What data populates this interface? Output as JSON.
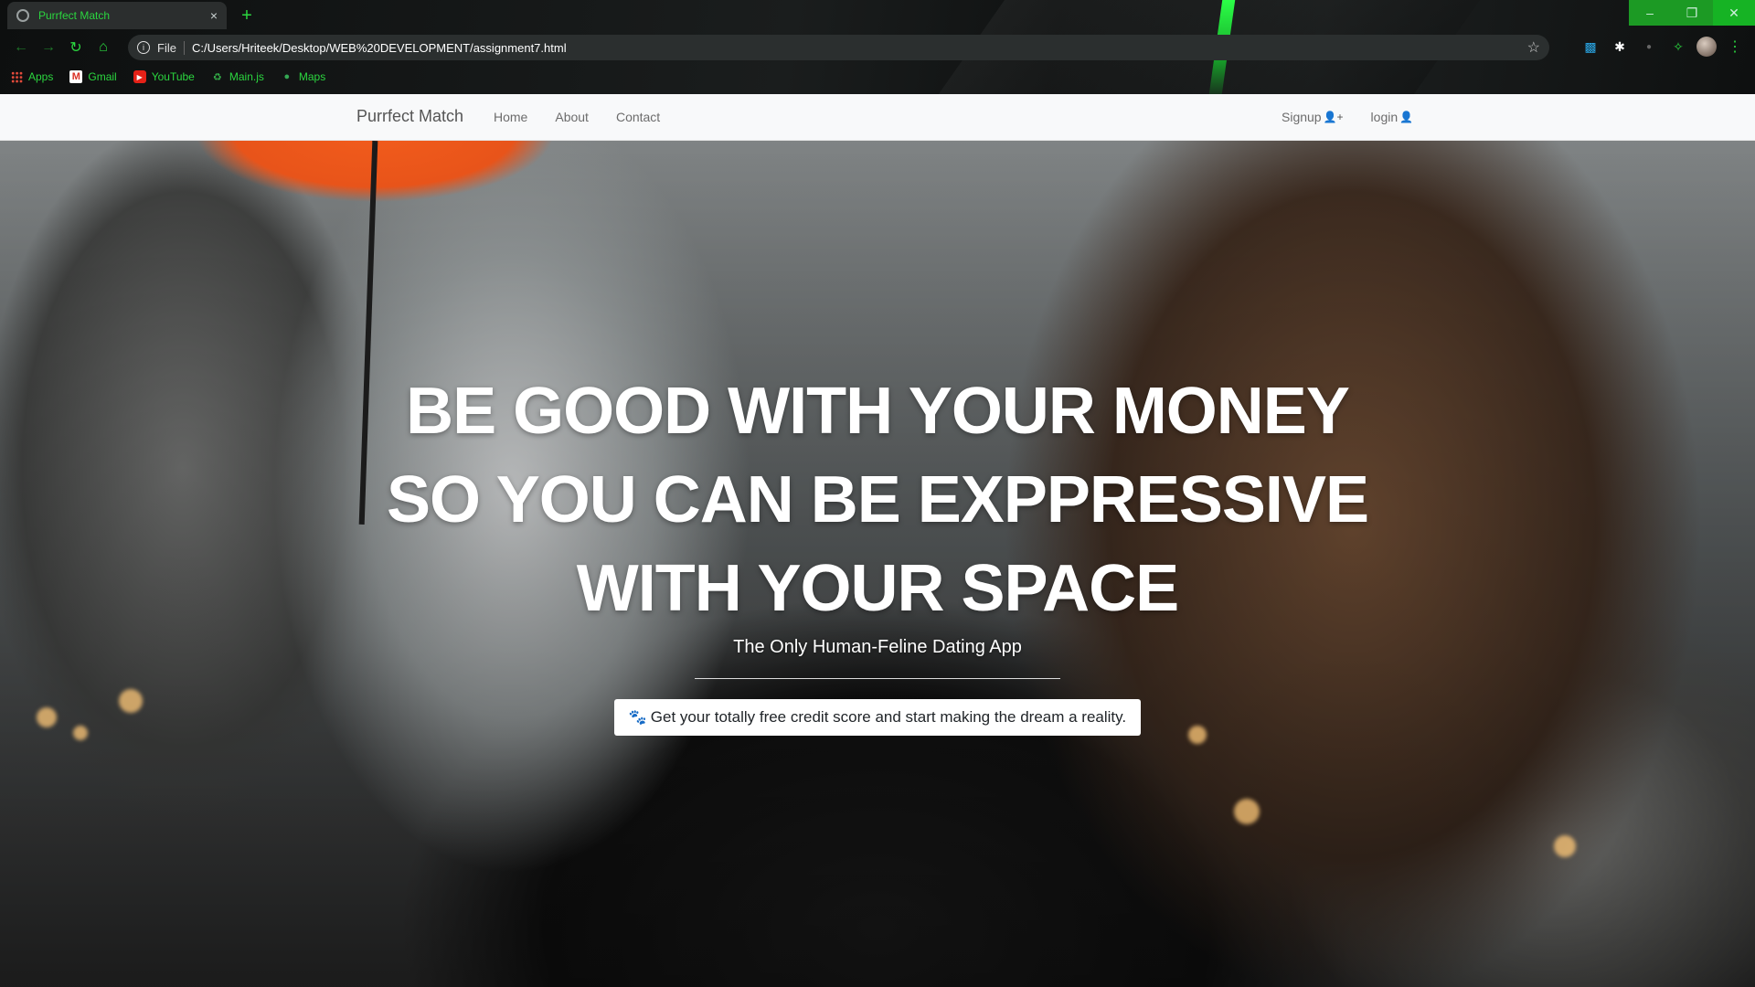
{
  "browser": {
    "tab_title": "Purrfect Match",
    "tab_close": "×",
    "new_tab": "+",
    "window_controls": {
      "minimize": "–",
      "restore": "❐",
      "close": "✕"
    },
    "omnibox": {
      "scheme": "File",
      "url": "C:/Users/Hriteek/Desktop/WEB%20DEVELOPMENT/assignment7.html"
    },
    "bookmarks": [
      {
        "label": "Apps",
        "icon": "apps-grid-icon"
      },
      {
        "label": "Gmail",
        "icon": "gmail-icon"
      },
      {
        "label": "YouTube",
        "icon": "youtube-icon"
      },
      {
        "label": "Main.js",
        "icon": "mainjs-icon"
      },
      {
        "label": "Maps",
        "icon": "maps-pin-icon"
      }
    ],
    "theme_accent": "#2bd63f"
  },
  "navbar": {
    "brand": "Purrfect Match",
    "links": [
      "Home",
      "About",
      "Contact"
    ],
    "signup": "Signup",
    "login": "login"
  },
  "hero": {
    "headline_lines": [
      "BE GOOD WITH YOUR MONEY",
      "SO YOU CAN BE EXPPRESSIVE",
      "WITH YOUR SPACE"
    ],
    "subheading": "The Only Human-Feline Dating App",
    "cta_label": "Get your totally free credit score and start making the dream a reality."
  }
}
